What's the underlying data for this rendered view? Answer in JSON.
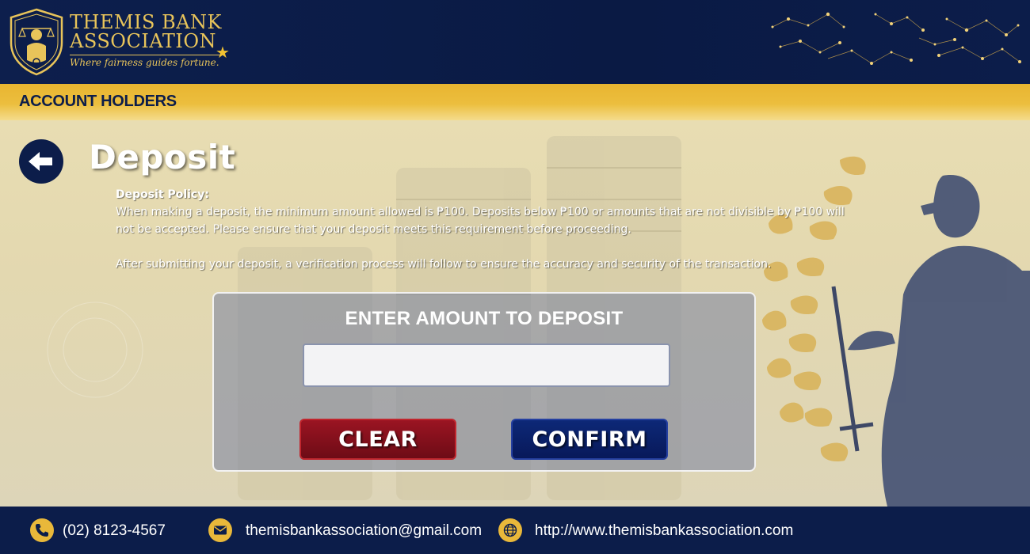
{
  "header": {
    "brand_line1": "THEMIS BANK",
    "brand_line2": "ASSOCIATION",
    "tagline": "Where fairness guides fortune."
  },
  "subbar": {
    "title": "ACCOUNT HOLDERS"
  },
  "page": {
    "title": "Deposit",
    "back_icon": "arrow-left-icon"
  },
  "policy": {
    "heading": "Deposit Policy:",
    "paragraph1": "When making a deposit, the minimum amount allowed is ₱100. Deposits below ₱100 or amounts that are not divisible by ₱100 will not be accepted. Please ensure that your deposit meets this requirement before proceeding.",
    "paragraph2": "After submitting your deposit, a verification process will follow to ensure the accuracy and security of the transaction."
  },
  "deposit_form": {
    "title": "ENTER AMOUNT TO DEPOSIT",
    "amount_value": "",
    "amount_placeholder": "",
    "clear_label": "CLEAR",
    "confirm_label": "CONFIRM"
  },
  "footer": {
    "phone": "(02) 8123-4567",
    "email": "themisbankassociation@gmail.com",
    "website": "http://www.themisbankassociation.com"
  },
  "colors": {
    "navy": "#0c1d4a",
    "gold": "#e8c45a",
    "subbar_gold": "#ecbe3e",
    "clear_red": "#8a1220",
    "confirm_blue": "#0b2270"
  }
}
